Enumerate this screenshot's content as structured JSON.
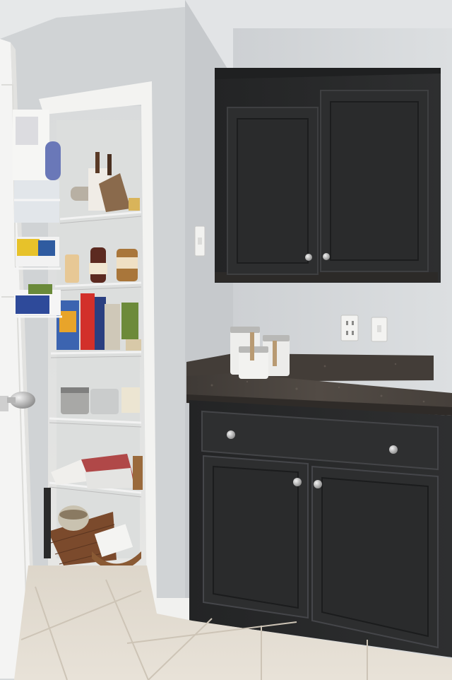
{
  "scene": {
    "description_free": true,
    "colors": {
      "wall": "#d3d6d8",
      "wall_shadow": "#c2c5c8",
      "ceiling": "#e4e6e8",
      "cabinet": "#2a2b2c",
      "cabinet_edge": "#3d3e40",
      "countertop": "#4a4440",
      "floor_tile": "#e3ddd2",
      "grout": "#cfc7ba",
      "trim": "#f4f4f2",
      "shelf_wire": "#f0f0f0",
      "knob": "#c8c8c8"
    },
    "icons": {
      "knob": "round-knob-icon",
      "outlet": "power-outlet-icon",
      "switch": "light-switch-icon",
      "doorknob": "doorknob-icon"
    }
  }
}
